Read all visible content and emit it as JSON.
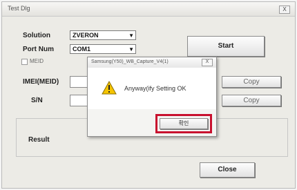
{
  "window": {
    "title": "Test Dlg",
    "close_label": "X"
  },
  "form": {
    "solution_label": "Solution",
    "solution_value": "ZVERON",
    "port_label": "Port Num",
    "port_value": "COM1",
    "imei_label": "IMEI(MEID)",
    "sn_label": "S/N",
    "copy_label": "Copy",
    "result_label": "Result",
    "start_label": "Start",
    "close_label": "Close",
    "checkbox_label": "MEID"
  },
  "dialog": {
    "title": "Samsung(Y50)_WB_Capture_V4(1)",
    "message": "Anyway(ify Setting OK",
    "ok_label": "확인"
  },
  "colors": {
    "highlight": "#c8102e"
  }
}
